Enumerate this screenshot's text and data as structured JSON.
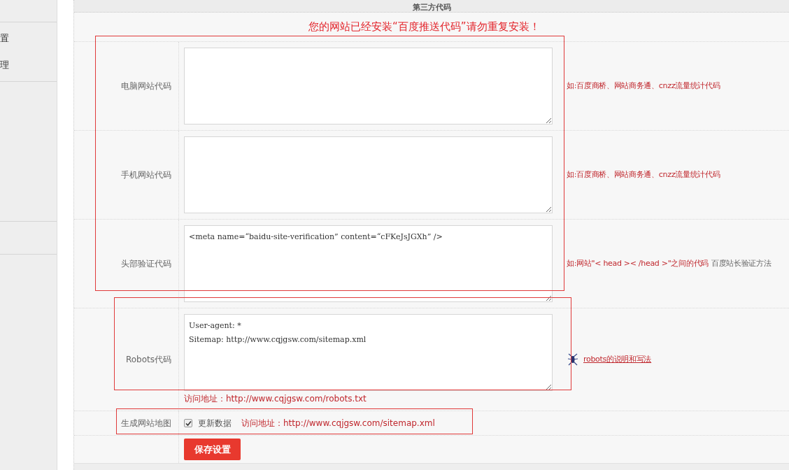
{
  "sidebar": {
    "items": [
      {
        "label": "置"
      },
      {
        "label": "理"
      }
    ]
  },
  "section": {
    "title": "第三方代码",
    "notice": "您的网站已经安装“百度推送代码”请勿重复安装！"
  },
  "fields": [
    {
      "kind": "textarea",
      "label": "电脑网站代码",
      "hint": "如:百度商桥、网站商务通、cnzz流量统计代码"
    },
    {
      "kind": "textarea",
      "label": "手机网站代码",
      "hint": "如:百度商桥、网站商务通、cnzz流量统计代码"
    },
    {
      "kind": "textarea",
      "label": "头部验证代码",
      "value": "<meta name=“baidu-site-verification” content=“cFKeJsJGXh” />",
      "hint": "如:网站\"< head >< /head >\"之间的代码",
      "link": "百度站长验证方法"
    },
    {
      "kind": "textarea",
      "label": "Robots代码",
      "value": "User-agent: *\nSitemap: http://www.cqjgsw.com/sitemap.xml",
      "link": "robots的说明和写法",
      "note": "访问地址：http://www.cqjgsw.com/robots.txt"
    },
    {
      "kind": "checkbox",
      "label": "生成网站地图",
      "option": "更新数据",
      "checked": true,
      "note": "访问地址：http://www.cqjgsw.com/sitemap.xml"
    }
  ],
  "save_button": "保存设置"
}
